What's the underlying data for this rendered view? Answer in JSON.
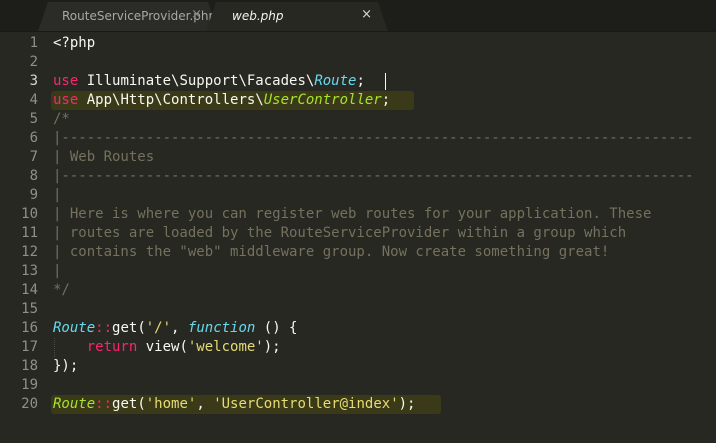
{
  "tabs": [
    {
      "label": "RouteServiceProvider.php",
      "close": "×",
      "active": false
    },
    {
      "label": "web.php",
      "close": "×",
      "active": true
    }
  ],
  "editor": {
    "lines": [
      {
        "num": "1",
        "parts": [
          {
            "t": "<?php",
            "c": "pl"
          }
        ]
      },
      {
        "num": "2",
        "parts": []
      },
      {
        "num": "3",
        "parts": [
          {
            "t": "use",
            "c": "kw"
          },
          {
            "t": " Illuminate\\Support\\Facades\\",
            "c": "pl"
          },
          {
            "t": "Route",
            "c": "type"
          },
          {
            "t": ";",
            "c": "pl"
          }
        ]
      },
      {
        "num": "4",
        "parts": [
          {
            "t": "use",
            "c": "kw"
          },
          {
            "t": " App\\Http\\Controllers\\",
            "c": "pl"
          },
          {
            "t": "UserController",
            "c": "cls"
          },
          {
            "t": ";",
            "c": "pl"
          }
        ]
      },
      {
        "num": "5",
        "parts": [
          {
            "t": "/*",
            "c": "cm"
          }
        ]
      },
      {
        "num": "6",
        "parts": [
          {
            "t": "|---------------------------------------------------------------------------",
            "c": "cm"
          }
        ]
      },
      {
        "num": "7",
        "parts": [
          {
            "t": "| Web Routes",
            "c": "cm"
          }
        ]
      },
      {
        "num": "8",
        "parts": [
          {
            "t": "|---------------------------------------------------------------------------",
            "c": "cm"
          }
        ]
      },
      {
        "num": "9",
        "parts": [
          {
            "t": "|",
            "c": "cm"
          }
        ]
      },
      {
        "num": "10",
        "parts": [
          {
            "t": "| Here is where you can register web routes for your application. These",
            "c": "cm"
          }
        ]
      },
      {
        "num": "11",
        "parts": [
          {
            "t": "| routes are loaded by the RouteServiceProvider within a group which",
            "c": "cm"
          }
        ]
      },
      {
        "num": "12",
        "parts": [
          {
            "t": "| contains the \"web\" middleware group. Now create something great!",
            "c": "cm"
          }
        ]
      },
      {
        "num": "13",
        "parts": [
          {
            "t": "|",
            "c": "cm"
          }
        ]
      },
      {
        "num": "14",
        "parts": [
          {
            "t": "*/",
            "c": "cm"
          }
        ]
      },
      {
        "num": "15",
        "parts": []
      },
      {
        "num": "16",
        "parts": [
          {
            "t": "Route",
            "c": "type"
          },
          {
            "t": "::",
            "c": "kw"
          },
          {
            "t": "get",
            "c": "fn"
          },
          {
            "t": "(",
            "c": "pl"
          },
          {
            "t": "'/'",
            "c": "str"
          },
          {
            "t": ", ",
            "c": "pl"
          },
          {
            "t": "function",
            "c": "type"
          },
          {
            "t": " () {",
            "c": "pl"
          }
        ]
      },
      {
        "num": "17",
        "parts": [
          {
            "t": "    ",
            "c": "pl"
          },
          {
            "t": "return",
            "c": "kw"
          },
          {
            "t": " view(",
            "c": "pl"
          },
          {
            "t": "'welcome'",
            "c": "str"
          },
          {
            "t": ");",
            "c": "pl"
          }
        ]
      },
      {
        "num": "18",
        "parts": [
          {
            "t": "});",
            "c": "pl"
          }
        ]
      },
      {
        "num": "19",
        "parts": []
      },
      {
        "num": "20",
        "parts": [
          {
            "t": "Route",
            "c": "cls"
          },
          {
            "t": "::",
            "c": "kw"
          },
          {
            "t": "get",
            "c": "fn"
          },
          {
            "t": "(",
            "c": "pl"
          },
          {
            "t": "'home'",
            "c": "str"
          },
          {
            "t": ", ",
            "c": "pl"
          },
          {
            "t": "'UserController@index'",
            "c": "str"
          },
          {
            "t": ");",
            "c": "pl"
          }
        ]
      }
    ]
  }
}
